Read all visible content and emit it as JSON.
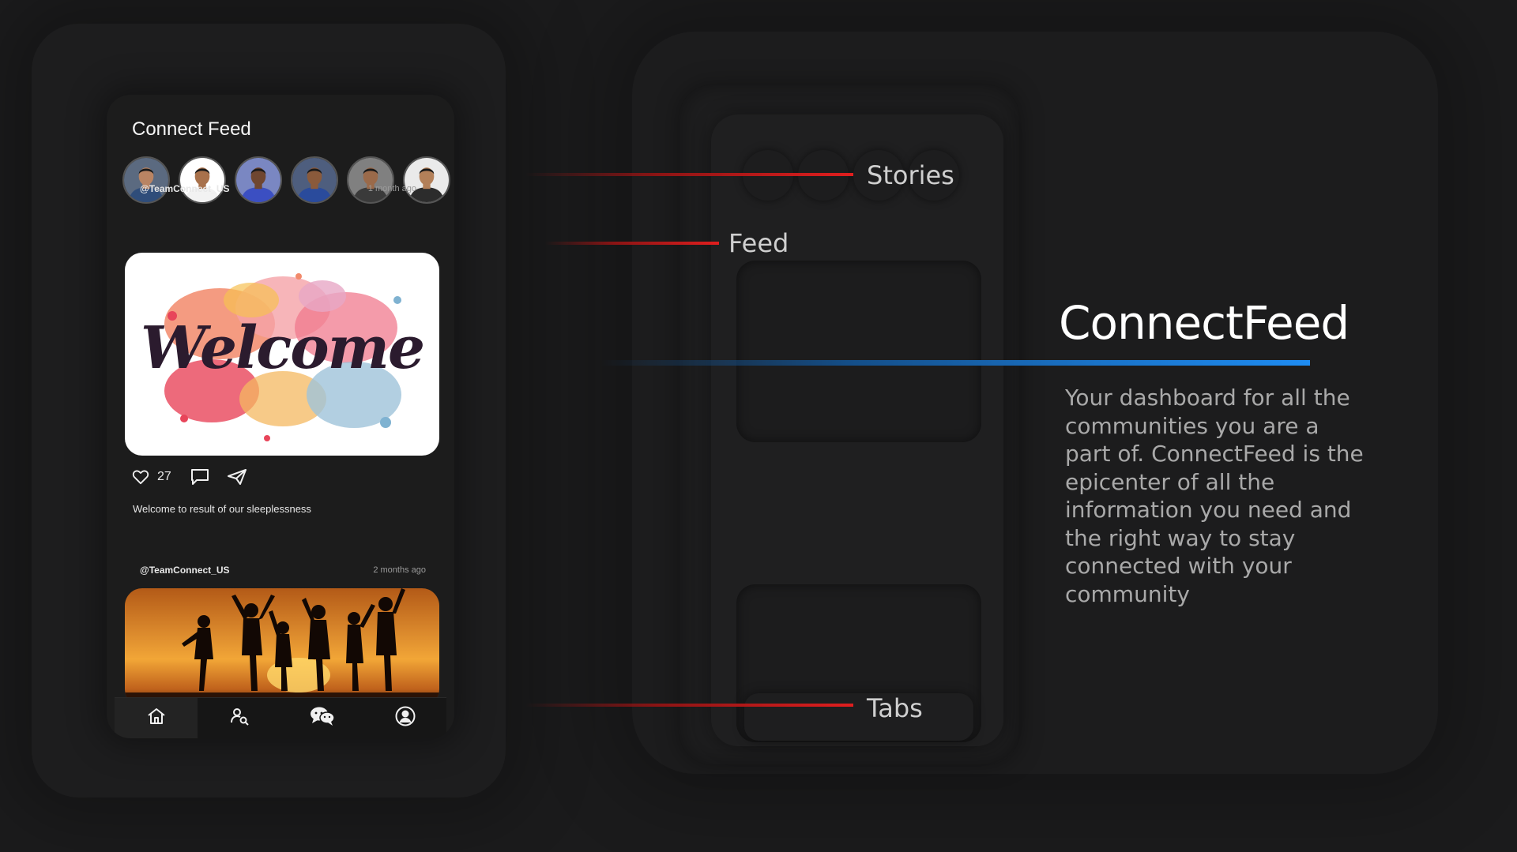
{
  "app": {
    "title": "Connect Feed"
  },
  "stories": [
    {
      "name": "story-1",
      "shirt": "#2f4d7a",
      "skin": "#b98463",
      "bg": "#5b6a80"
    },
    {
      "name": "story-2",
      "shirt": "#f2f2f2",
      "skin": "#a8714b",
      "bg": "#ffffff"
    },
    {
      "name": "story-3",
      "shirt": "#3b4fc2",
      "skin": "#6f4630",
      "bg": "#7a87c2"
    },
    {
      "name": "story-4",
      "shirt": "#2a4b9c",
      "skin": "#8a5a3b",
      "bg": "#4e5e7e"
    },
    {
      "name": "story-5",
      "shirt": "#3a3a3a",
      "skin": "#9a6a4a",
      "bg": "#808080"
    },
    {
      "name": "story-6",
      "shirt": "#2c2c2c",
      "skin": "#b38059",
      "bg": "#eaeaea"
    }
  ],
  "posts": [
    {
      "handle": "@TeamConnect_US",
      "time": "1 month ago",
      "image_text": "Welcome",
      "likes": "27",
      "caption": "Welcome to result of our sleeplessness"
    },
    {
      "handle": "@TeamConnect_US",
      "time": "2 months ago"
    }
  ],
  "tabs": [
    {
      "icon": "home-icon",
      "active": true
    },
    {
      "icon": "user-search-icon",
      "active": false
    },
    {
      "icon": "chat-icon",
      "active": false
    },
    {
      "icon": "profile-icon",
      "active": false
    }
  ],
  "annotations": {
    "stories": "Stories",
    "feed": "Feed",
    "tabs": "Tabs"
  },
  "hero": {
    "title": "ConnectFeed",
    "description": "Your dashboard for all the\ncommunities you are a\npart of.  ConnectFeed is the\nepicenter of all the\ninformation you need and\nthe right way to stay\nconnected with your\ncommunity"
  },
  "colors": {
    "background": "#1b1b1c",
    "annotation_red": "#e01e1e",
    "annotation_blue": "#1e8cf2"
  }
}
